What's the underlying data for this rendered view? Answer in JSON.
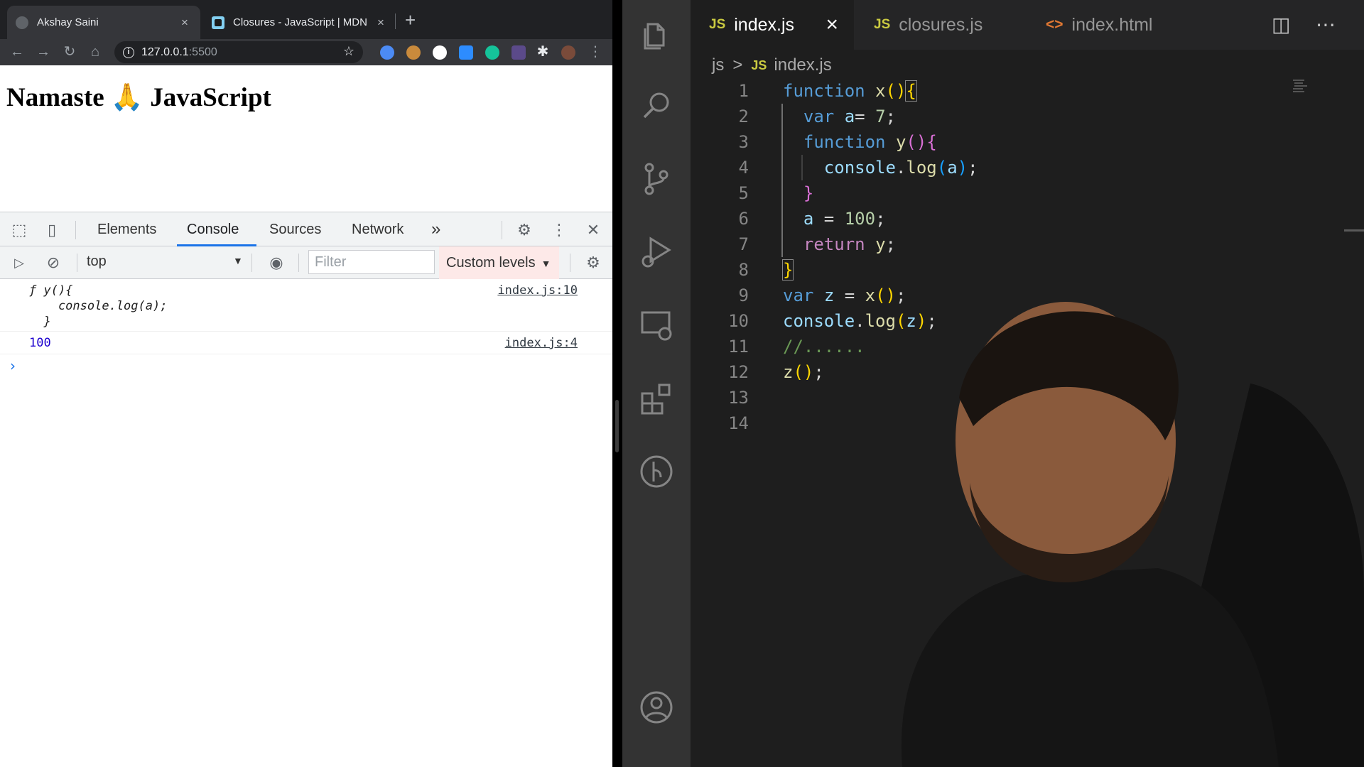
{
  "browser": {
    "tabs": [
      {
        "title": "Akshay Saini",
        "close": "×",
        "active": true
      },
      {
        "title": "Closures - JavaScript | MDN",
        "close": "×",
        "active": false
      }
    ],
    "new_tab": "+",
    "url_host": "127.0.0.1",
    "url_port": ":5500",
    "page_heading": "Namaste 🙏 JavaScript"
  },
  "devtools": {
    "tabs": [
      "Elements",
      "Console",
      "Sources",
      "Network"
    ],
    "active_tab": "Console",
    "more_tabs": "»",
    "context": "top",
    "filter_placeholder": "Filter",
    "levels": "Custom levels",
    "console": [
      {
        "line1": "ƒ y(){",
        "line2": "    console.log(a);",
        "line3": "  }",
        "source": "index.js:10"
      },
      {
        "value": "100",
        "source": "index.js:4"
      }
    ],
    "prompt": "›"
  },
  "vscode": {
    "tabs": [
      {
        "badge": "JS",
        "name": "index.js",
        "active": true,
        "close": "×"
      },
      {
        "badge": "JS",
        "name": "closures.js",
        "active": false
      },
      {
        "badge": "<>",
        "name": "index.html",
        "active": false
      }
    ],
    "breadcrumb": {
      "folder": "js",
      "sep": ">",
      "badge": "JS",
      "file": "index.js"
    },
    "line_numbers": [
      "1",
      "2",
      "3",
      "4",
      "5",
      "6",
      "7",
      "8",
      "9",
      "10",
      "11",
      "12",
      "13",
      "14"
    ],
    "code_text": {
      "function": "function",
      "var": "var",
      "return": "return",
      "x_name": "x",
      "y_name": "y",
      "a_decl": "a",
      "a_decl_rest": "= ",
      "seven": "7",
      "console": "console",
      "log": "log",
      "hundred": "100",
      "z": "z",
      "comment": "//......"
    }
  },
  "colors": {
    "accent": "#1a73e8",
    "vscode_bg": "#1e1e1e",
    "activity_bar": "#333333",
    "keyword": "#569cd6",
    "function_name": "#dcdcaa",
    "variable": "#9cdcfe"
  }
}
